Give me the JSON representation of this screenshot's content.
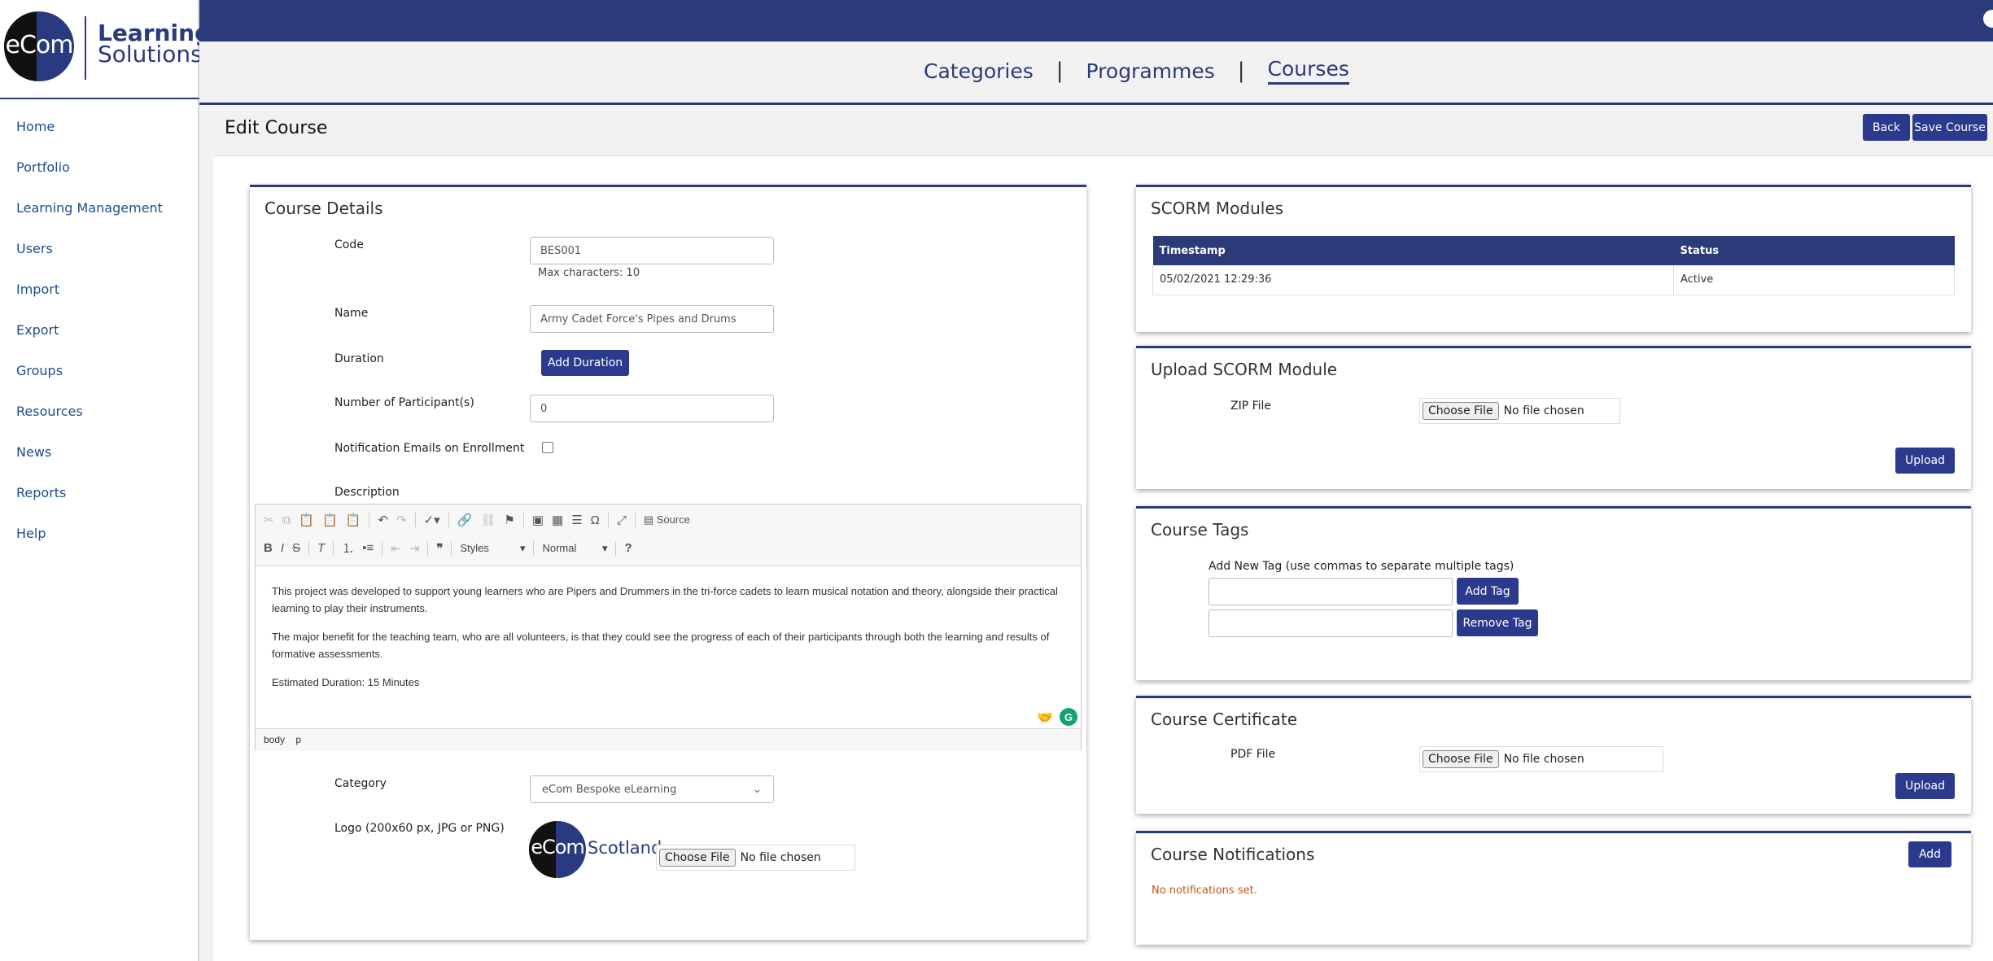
{
  "brand": {
    "logo_short": "eCom",
    "logo_line1": "Learning",
    "logo_line2": "Solutions"
  },
  "sidebar": {
    "items": [
      {
        "label": "Home"
      },
      {
        "label": "Portfolio"
      },
      {
        "label": "Learning Management"
      },
      {
        "label": "Users"
      },
      {
        "label": "Import"
      },
      {
        "label": "Export"
      },
      {
        "label": "Groups"
      },
      {
        "label": "Resources"
      },
      {
        "label": "News"
      },
      {
        "label": "Reports"
      },
      {
        "label": "Help"
      }
    ]
  },
  "subnav": {
    "categories": "Categories",
    "programmes": "Programmes",
    "courses": "Courses",
    "separator": "|"
  },
  "page": {
    "title": "Edit Course",
    "back_label": "Back",
    "save_label": "Save Course"
  },
  "course_details": {
    "title": "Course Details",
    "code_label": "Code",
    "code_value": "BES001",
    "code_hint": "Max characters: 10",
    "name_label": "Name",
    "name_value": "Army Cadet Force's Pipes and Drums",
    "duration_label": "Duration",
    "add_duration_label": "Add Duration",
    "participants_label": "Number of Participant(s)",
    "participants_value": "0",
    "notify_label": "Notification Emails on Enrollment",
    "description_label": "Description",
    "category_label": "Category",
    "category_value": "eCom Bespoke eLearning",
    "logo_label": "Logo (200x60 px, JPG or PNG)",
    "logo_text": "Scotland",
    "choose_file": "Choose File",
    "no_file": "No file chosen"
  },
  "editor": {
    "source_label": "Source",
    "styles_label": "Styles",
    "format_label": "Normal",
    "paragraphs": [
      "This project was developed to support young learners who are Pipers and Drummers in the tri-force cadets to learn musical notation and theory, alongside their practical learning to play their instruments.",
      "The major benefit for the teaching team, who are all volunteers, is that they could see the progress of each of their participants through both the learning and results of formative assessments.",
      "Estimated Duration: 15 Minutes"
    ],
    "path_body": "body",
    "path_p": "p"
  },
  "scorm": {
    "title": "SCORM Modules",
    "headers": [
      "Timestamp",
      "Status"
    ],
    "rows": [
      {
        "timestamp": "05/02/2021 12:29:36",
        "status": "Active"
      }
    ]
  },
  "upload_scorm": {
    "title": "Upload SCORM Module",
    "zip_label": "ZIP File",
    "choose_file": "Choose File",
    "no_file": "No file chosen",
    "upload_label": "Upload"
  },
  "tags": {
    "title": "Course Tags",
    "add_label": "Add New Tag (use commas to separate multiple tags)",
    "add_button": "Add Tag",
    "remove_button": "Remove Tag"
  },
  "certificate": {
    "title": "Course Certificate",
    "pdf_label": "PDF File",
    "choose_file": "Choose File",
    "no_file": "No file chosen",
    "upload_label": "Upload"
  },
  "notifications": {
    "title": "Course Notifications",
    "add_label": "Add",
    "empty_text": "No notifications set.",
    "empty_color": "#c0561b"
  }
}
